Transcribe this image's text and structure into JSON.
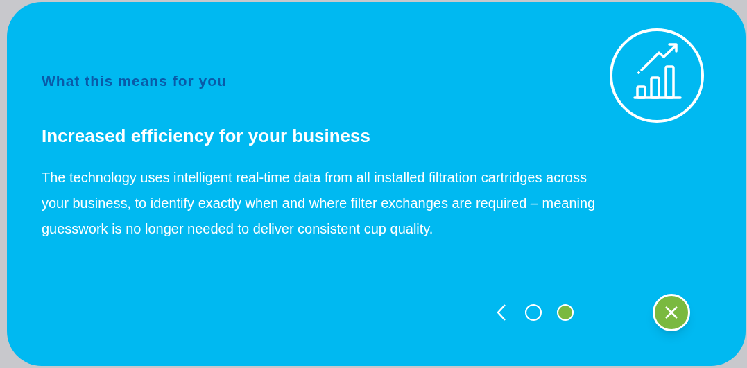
{
  "eyebrow": "What this means for you",
  "heading": "Increased efficiency for your business",
  "body": "The technology uses intelligent real-time data from all installed filtration cartridges across your business, to identify exactly when and where filter exchanges are required – meaning guesswork is no longer needed to deliver consistent cup quality.",
  "pager": [
    {
      "selected": false
    },
    {
      "selected": true
    }
  ]
}
